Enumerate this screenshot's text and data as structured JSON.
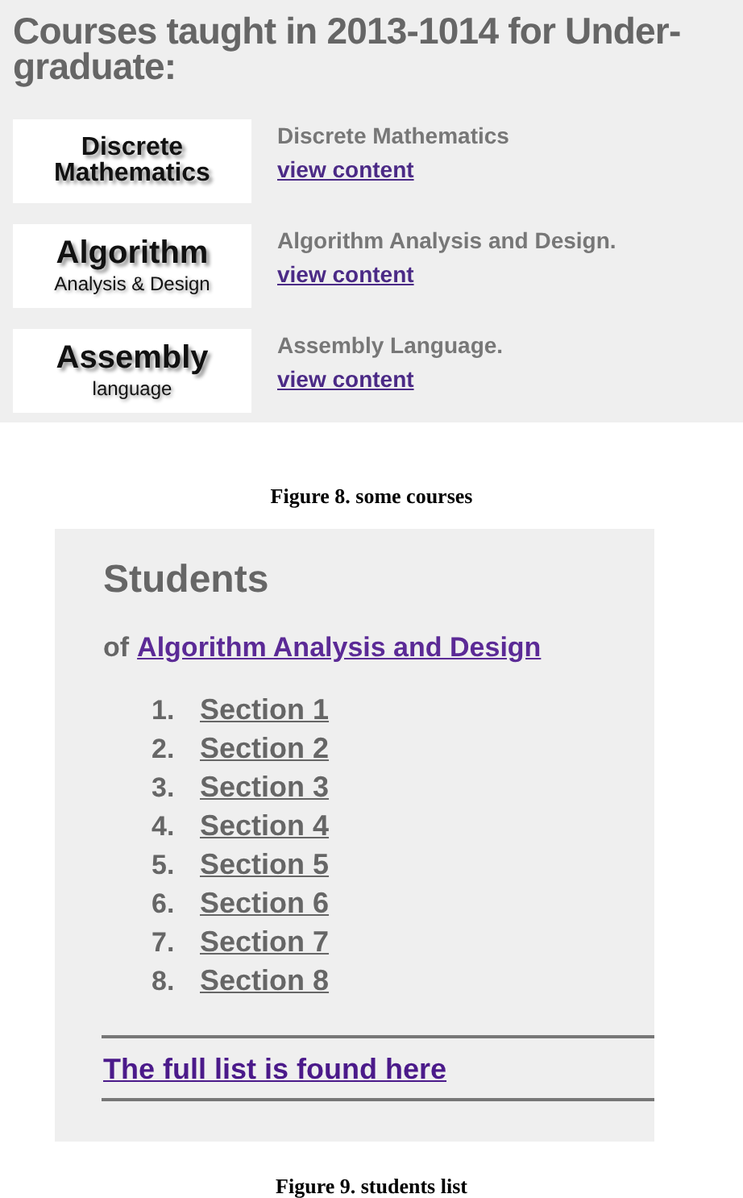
{
  "courses_panel": {
    "title": "Courses taught in 2013-1014 for Under-graduate:",
    "courses": [
      {
        "logo_title": "Discrete",
        "logo_subtitle": "Mathematics",
        "kind": "two-line",
        "name": "Discrete Mathematics",
        "link": "view content"
      },
      {
        "logo_title": "Algorithm",
        "logo_subtitle": "Analysis & Design",
        "kind": "title-subtitle",
        "name": "Algorithm Analysis and Design.",
        "link": "view content"
      },
      {
        "logo_title": "Assembly",
        "logo_subtitle": "language",
        "kind": "title-subtitle",
        "name": "Assembly Language.",
        "link": "view content"
      }
    ]
  },
  "caption_1": "Figure 8. some courses",
  "students_panel": {
    "title": "Students",
    "of_label": "of",
    "course_link": "Algorithm Analysis and Design",
    "sections": [
      {
        "number": "1.",
        "label": "Section 1"
      },
      {
        "number": "2.",
        "label": "Section 2"
      },
      {
        "number": "3.",
        "label": "Section 3"
      },
      {
        "number": "4.",
        "label": "Section 4"
      },
      {
        "number": "5.",
        "label": "Section 5"
      },
      {
        "number": "6.",
        "label": "Section 6"
      },
      {
        "number": "7.",
        "label": "Section 7"
      },
      {
        "number": "8.",
        "label": "Section 8"
      }
    ],
    "full_list_link": "The full list is found here"
  },
  "caption_2": "Figure 9. students list"
}
